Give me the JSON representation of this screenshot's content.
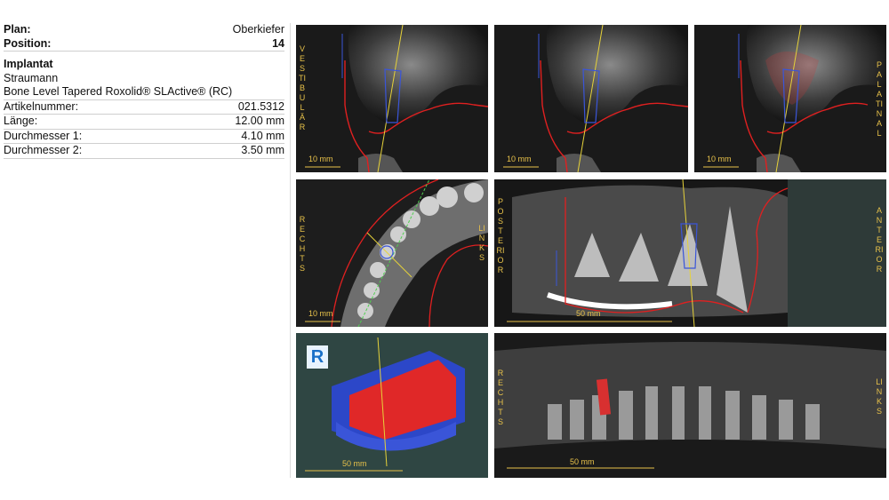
{
  "plan": {
    "label": "Plan:",
    "value": "Oberkiefer"
  },
  "position": {
    "label": "Position:",
    "value": "14"
  },
  "implant": {
    "heading": "Implantat",
    "manufacturer": "Straumann",
    "model": "Bone Level Tapered Roxolid® SLActive® (RC)",
    "rows": [
      {
        "label": "Artikelnummer:",
        "value": "021.5312"
      },
      {
        "label": "Länge:",
        "value": "12.00 mm"
      },
      {
        "label": "Durchmesser 1:",
        "value": "4.10 mm"
      },
      {
        "label": "Durchmesser 2:",
        "value": "3.50 mm"
      }
    ]
  },
  "labels": {
    "vestibular": "VESTIBULÄR",
    "palatinal": "PALATINAL",
    "rechts": "RECHTS",
    "links": "LINKS",
    "posterior": "POSTERIOR",
    "anterior": "ANTERIOR"
  },
  "scale": {
    "ten_mm": "10 mm",
    "fifty_mm": "50 mm"
  },
  "logo": {
    "letter": "R"
  },
  "colors": {
    "accent_label": "#e8c24a",
    "nerve_line": "#e02020",
    "axis_line": "#e6d23a",
    "implant": "#3a55d8"
  }
}
